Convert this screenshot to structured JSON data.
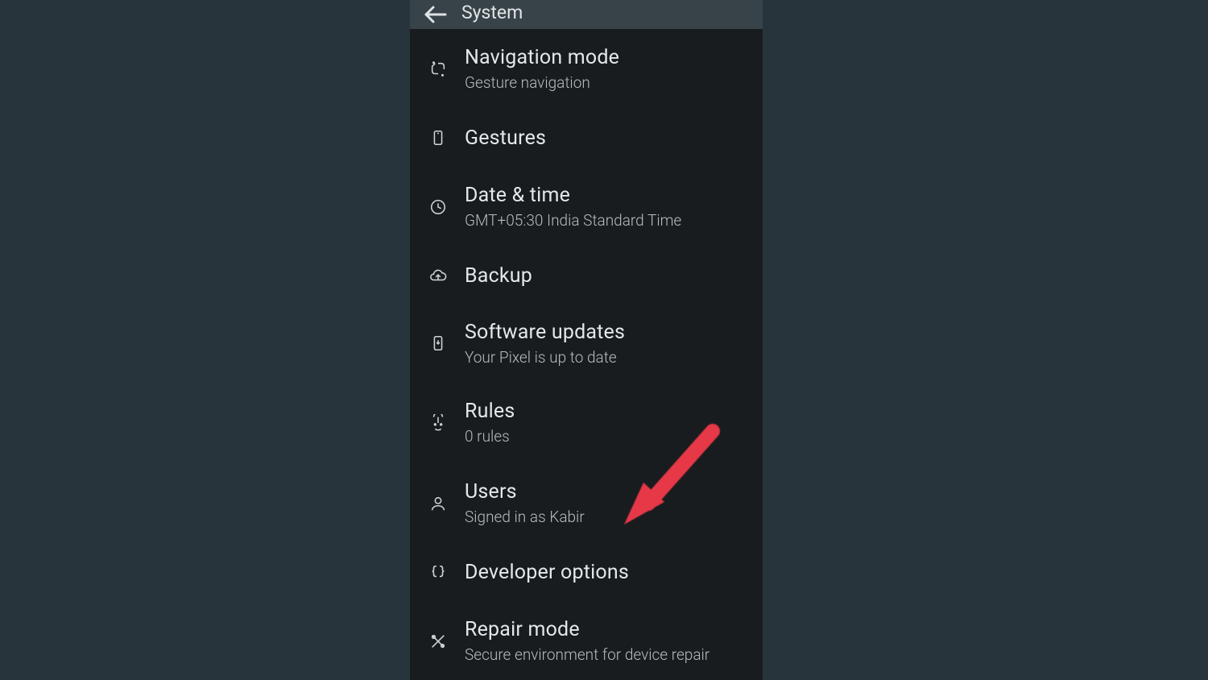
{
  "header": {
    "title": "System"
  },
  "items": [
    {
      "title": "Navigation mode",
      "sub": "Gesture navigation"
    },
    {
      "title": "Gestures",
      "sub": ""
    },
    {
      "title": "Date & time",
      "sub": "GMT+05:30 India Standard Time"
    },
    {
      "title": "Backup",
      "sub": ""
    },
    {
      "title": "Software updates",
      "sub": "Your Pixel is up to date"
    },
    {
      "title": "Rules",
      "sub": "0 rules"
    },
    {
      "title": "Users",
      "sub": "Signed in as Kabir"
    },
    {
      "title": "Developer options",
      "sub": ""
    },
    {
      "title": "Repair mode",
      "sub": "Secure environment for device repair"
    }
  ]
}
